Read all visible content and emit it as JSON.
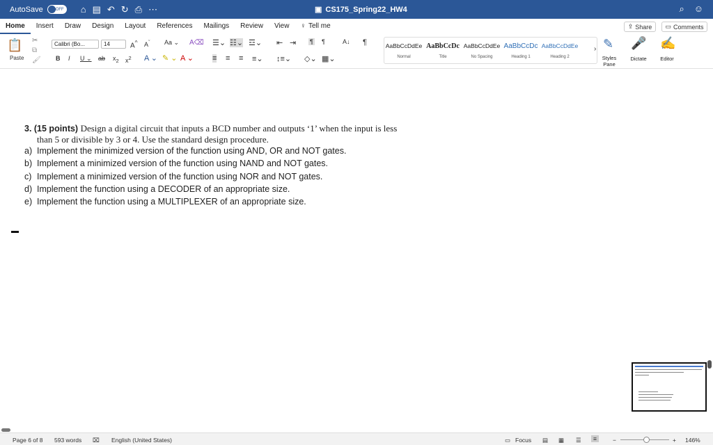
{
  "titlebar": {
    "autosave_label": "AutoSave",
    "autosave_state": "OFF",
    "doc_title": "CS175_Spring22_HW4"
  },
  "tabs": [
    {
      "label": "Home"
    },
    {
      "label": "Insert"
    },
    {
      "label": "Draw"
    },
    {
      "label": "Design"
    },
    {
      "label": "Layout"
    },
    {
      "label": "References"
    },
    {
      "label": "Mailings"
    },
    {
      "label": "Review"
    },
    {
      "label": "View"
    }
  ],
  "tell_me": "Tell me",
  "share_label": "Share",
  "comments_label": "Comments",
  "ribbon": {
    "paste_label": "Paste",
    "font_name": "Calibri (Bo...",
    "font_size": "14",
    "styles": [
      {
        "sample": "AaBbCcDdEe",
        "label": "Normal"
      },
      {
        "sample": "AaBbCcDc",
        "label": "Title"
      },
      {
        "sample": "AaBbCcDdEe",
        "label": "No Spacing"
      },
      {
        "sample": "AaBbCcDc",
        "label": "Heading 1"
      },
      {
        "sample": "AaBbCcDdEe",
        "label": "Heading 2"
      }
    ],
    "styles_pane_label": "Styles Pane",
    "dictate_label": "Dictate",
    "editor_label": "Editor"
  },
  "document": {
    "q_number": "3. (15 points)",
    "q_text": "Design a digital circuit that inputs a BCD number and outputs ‘1’ when the input is less than 5 or divisible by 3 or 4. Use the standard design procedure.",
    "items": [
      {
        "letter": "a)",
        "text": "Implement the minimized version of the function using AND, OR and NOT gates."
      },
      {
        "letter": "b)",
        "text": "Implement a minimized version of the function using NAND and NOT gates."
      },
      {
        "letter": "c)",
        "text": "Implement a minimized version of the function using NOR and NOT gates."
      },
      {
        "letter": "d)",
        "text": "Implement the function using a DECODER of an appropriate size."
      },
      {
        "letter": "e)",
        "text": "Implement the function using a MULTIPLEXER of an appropriate size."
      }
    ]
  },
  "statusbar": {
    "page": "Page 6 of 8",
    "words": "593 words",
    "language": "English (United States)",
    "focus": "Focus",
    "zoom": "146%"
  },
  "colors": {
    "title_bar": "#2b5797"
  }
}
